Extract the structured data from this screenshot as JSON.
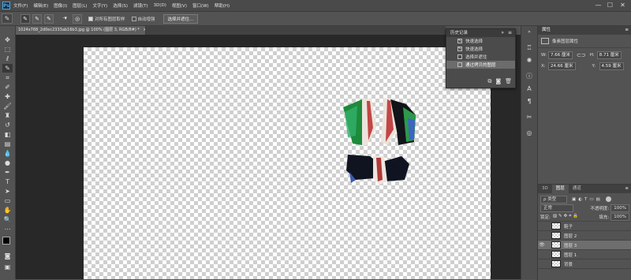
{
  "app": {
    "logo": "Ps",
    "menu": [
      "文件(F)",
      "编辑(E)",
      "图像(I)",
      "图层(L)",
      "文字(Y)",
      "选择(S)",
      "滤镜(T)",
      "3D(D)",
      "视图(V)",
      "窗口(W)",
      "帮助(H)"
    ],
    "window_controls": {
      "minimize": "—",
      "maximize": "☐",
      "close": "✕"
    }
  },
  "options_bar": {
    "sample_all_layers_label": "对所有图层取样",
    "sample_all_layers_checked": true,
    "auto_enhance_label": "自动增强",
    "auto_enhance_checked": false,
    "select_and_mask_label": "选择并遮住..."
  },
  "document": {
    "tab_title": "1024x768_2d0ec2333ab16b3.jpg @ 100% (图层 3, RGB/8#) *",
    "tab_close": "×"
  },
  "history_panel": {
    "title": "历史记录",
    "items": [
      {
        "label": "快速选择",
        "icon": "brush-icon",
        "selected": false
      },
      {
        "label": "快速选择",
        "icon": "brush-icon",
        "selected": false
      },
      {
        "label": "选择并遮住",
        "icon": "layer-icon",
        "selected": false
      },
      {
        "label": "通过拷贝的图层",
        "icon": "layer-icon",
        "selected": true
      }
    ]
  },
  "properties_panel": {
    "tab": "属性",
    "type_label": "像素图层属性",
    "w_label": "W:",
    "w_value": "7.66 厘米",
    "h_label": "H:",
    "h_value": "8.71 厘米",
    "x_label": "X:",
    "x_value": "24.66 厘米",
    "y_label": "Y:",
    "y_value": "4.59 厘米"
  },
  "layers_panel": {
    "tabs": [
      {
        "label": "3D",
        "active": false
      },
      {
        "label": "图层",
        "active": true
      },
      {
        "label": "通道",
        "active": false
      }
    ],
    "filter_label": "ρ 类型",
    "blend_mode": "正常",
    "opacity_label": "不透明度:",
    "opacity_value": "100%",
    "lock_label": "锁定:",
    "fill_label": "填充:",
    "fill_value": "100%",
    "layers": [
      {
        "name": "鞋子",
        "visible": false,
        "selected": false
      },
      {
        "name": "图层 2",
        "visible": false,
        "selected": false
      },
      {
        "name": "图层 3",
        "visible": true,
        "selected": true
      },
      {
        "name": "图层 1",
        "visible": false,
        "selected": false
      },
      {
        "name": "背景",
        "visible": false,
        "selected": false
      }
    ]
  },
  "colors": {
    "ui_bg": "#535353",
    "canvas_bg": "#282828",
    "selection": "#6e6e6e",
    "ps_blue": "#4ea8e6"
  }
}
